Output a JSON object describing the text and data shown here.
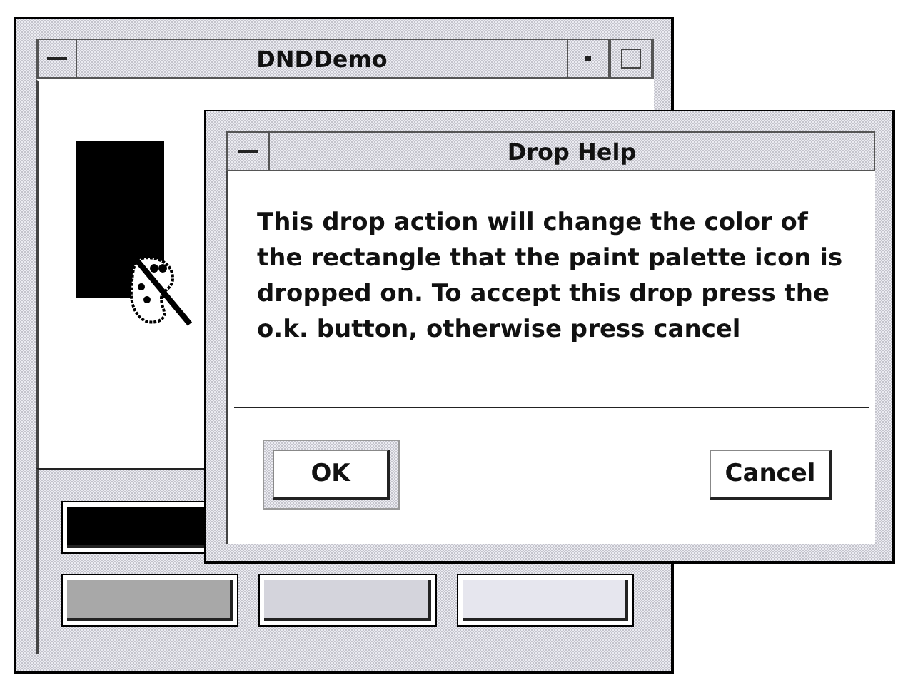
{
  "main_window": {
    "title": "DNDDemo"
  },
  "color_button_rows": [
    {
      "buttons": [
        {
          "color": "#000000"
        }
      ]
    },
    {
      "buttons": [
        {
          "color": "#a8a8a8"
        },
        {
          "color": "#d4d4dc"
        },
        {
          "color": "#e6e6ee"
        }
      ]
    }
  ],
  "dialog": {
    "title": "Drop Help",
    "message": "This drop action will change the color of the rectangle that the paint palette icon is dropped on. To accept this drop press the o.k. button, otherwise press cancel",
    "buttons": [
      {
        "label": "OK",
        "default": true
      },
      {
        "label": "Cancel",
        "default": false
      }
    ]
  }
}
